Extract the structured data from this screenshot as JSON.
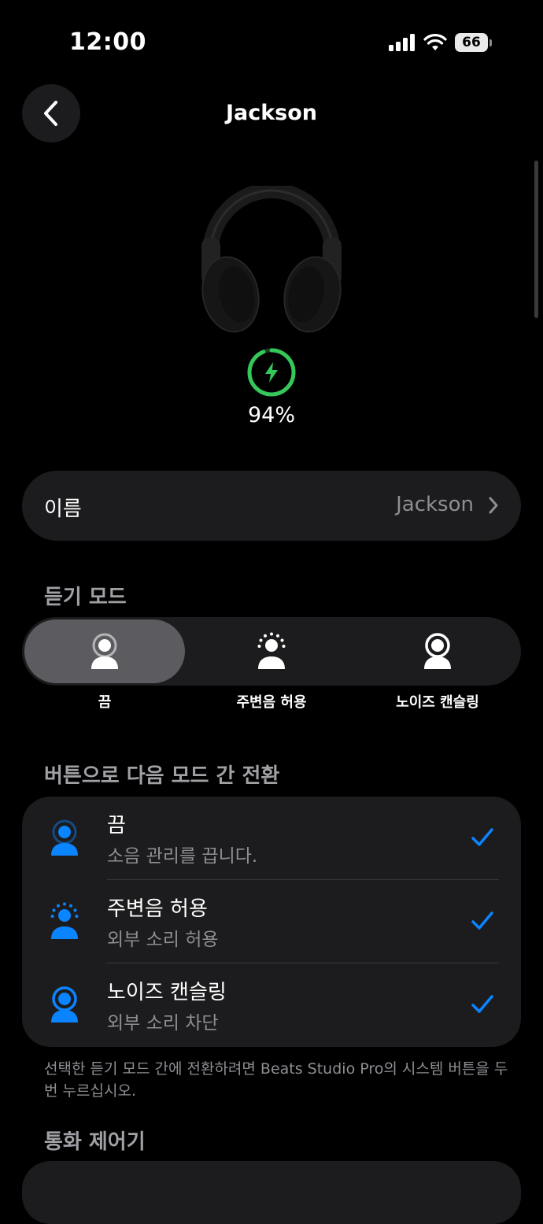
{
  "status_bar": {
    "time": "12:00",
    "battery": "66"
  },
  "nav": {
    "title": "Jackson"
  },
  "device": {
    "battery_percent": "94%",
    "battery_level": 0.94,
    "charging": true,
    "ring_color": "#34c759"
  },
  "name_row": {
    "label": "이름",
    "value": "Jackson"
  },
  "listening_mode": {
    "header": "듣기 모드",
    "options": [
      {
        "label": "끔",
        "selected": true
      },
      {
        "label": "주변음 허용",
        "selected": false
      },
      {
        "label": "노이즈 캔슬링",
        "selected": false
      }
    ]
  },
  "button_cycle": {
    "header": "버튼으로 다음 모드 간 전환",
    "items": [
      {
        "title": "끔",
        "subtitle": "소음 관리를 끕니다.",
        "checked": true,
        "icon": "person-off-icon"
      },
      {
        "title": "주변음 허용",
        "subtitle": "외부 소리 허용",
        "checked": true,
        "icon": "person-transparency-icon"
      },
      {
        "title": "노이즈 캔슬링",
        "subtitle": "외부 소리 차단",
        "checked": true,
        "icon": "person-noise-cancel-icon"
      }
    ],
    "footnote": "선택한 듣기 모드 간에 전환하려면 Beats Studio Pro의 시스템 버튼을 두 번 누르십시오."
  },
  "call_controls": {
    "header": "통화 제어기"
  },
  "colors": {
    "accent": "#0a84ff",
    "charge": "#34c759",
    "card": "#1c1c1e"
  }
}
